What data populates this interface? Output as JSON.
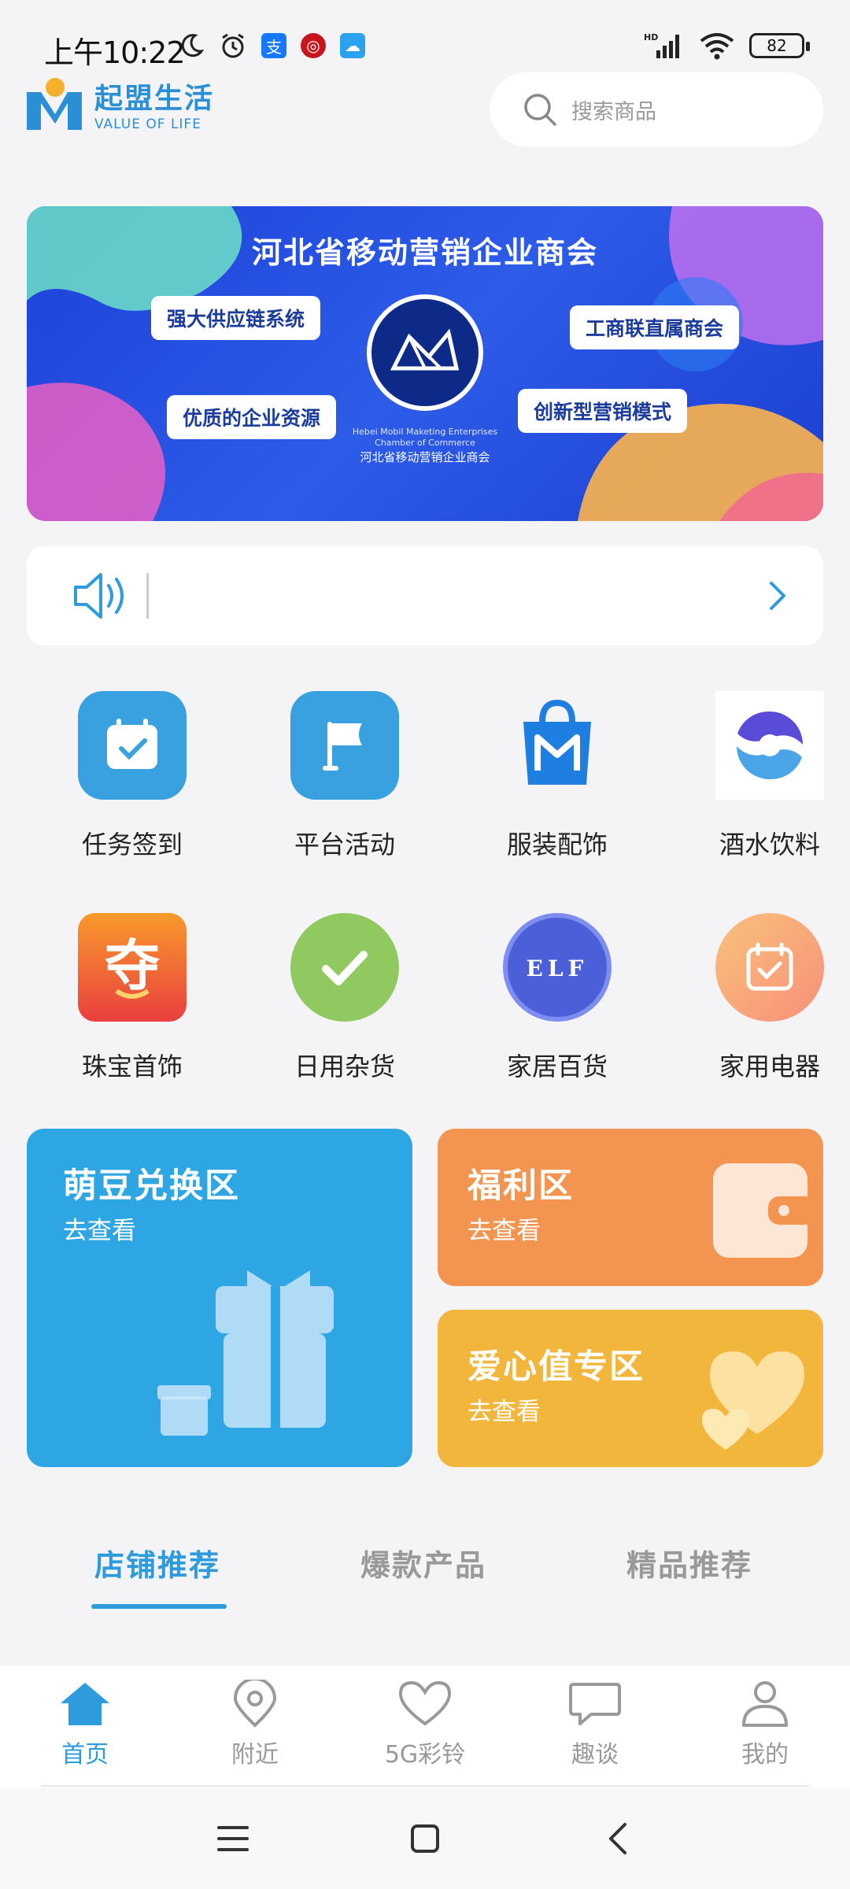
{
  "status_bar": {
    "time": "上午10:22",
    "network": "HD",
    "battery": "82"
  },
  "header": {
    "logo_cn": "起盟生活",
    "logo_en": "VALUE OF LIFE",
    "search_placeholder": "搜索商品"
  },
  "banner": {
    "title": "河北省移动营销企业商会",
    "pills": [
      "强大供应链系统",
      "工商联直属商会",
      "优质的企业资源",
      "创新型营销模式"
    ],
    "emblem_en": "Hebei Mobil Maketing Enterprises Chamber of Commerce",
    "emblem_cn": "河北省移动营销企业商会"
  },
  "notice": {
    "text": ""
  },
  "categories": [
    {
      "label": "任务签到",
      "icon": "calendar-check-icon",
      "color": "#3aa1e0"
    },
    {
      "label": "平台活动",
      "icon": "flag-icon",
      "color": "#3aa1e0"
    },
    {
      "label": "服装配饰",
      "icon": "shopping-bag-icon",
      "color": "#1f7fe0"
    },
    {
      "label": "酒水饮料",
      "icon": "swirl-logo-icon",
      "color": "#5a4bd8"
    },
    {
      "label": "珠宝首饰",
      "icon": "jewelry-logo-icon",
      "color": "#ef5a3a"
    },
    {
      "label": "日用杂货",
      "icon": "checkmark-icon",
      "color": "#8fc95f"
    },
    {
      "label": "家居百货",
      "icon": "elf-logo-icon",
      "color": "#4a5fd8"
    },
    {
      "label": "家用电器",
      "icon": "calendar-icon",
      "color": "#f8a77a"
    }
  ],
  "promos": {
    "exchange": {
      "title": "萌豆兑换区",
      "sub": "去查看",
      "color": "#2fa6e4"
    },
    "welfare": {
      "title": "福利区",
      "sub": "去查看",
      "color": "#f39550"
    },
    "love": {
      "title": "爱心值专区",
      "sub": "去查看",
      "color": "#f3b63c"
    }
  },
  "tabs": [
    {
      "label": "店铺推荐",
      "active": true
    },
    {
      "label": "爆款产品",
      "active": false
    },
    {
      "label": "精品推荐",
      "active": false
    }
  ],
  "bottom_nav": [
    {
      "label": "首页",
      "icon": "home-icon",
      "active": true
    },
    {
      "label": "附近",
      "icon": "location-pin-icon",
      "active": false
    },
    {
      "label": "5G彩铃",
      "icon": "heart-icon",
      "active": false
    },
    {
      "label": "趣谈",
      "icon": "chat-bubble-icon",
      "active": false
    },
    {
      "label": "我的",
      "icon": "user-icon",
      "active": false
    }
  ],
  "colors": {
    "accent": "#2e9bdc",
    "inactive": "#999999"
  }
}
